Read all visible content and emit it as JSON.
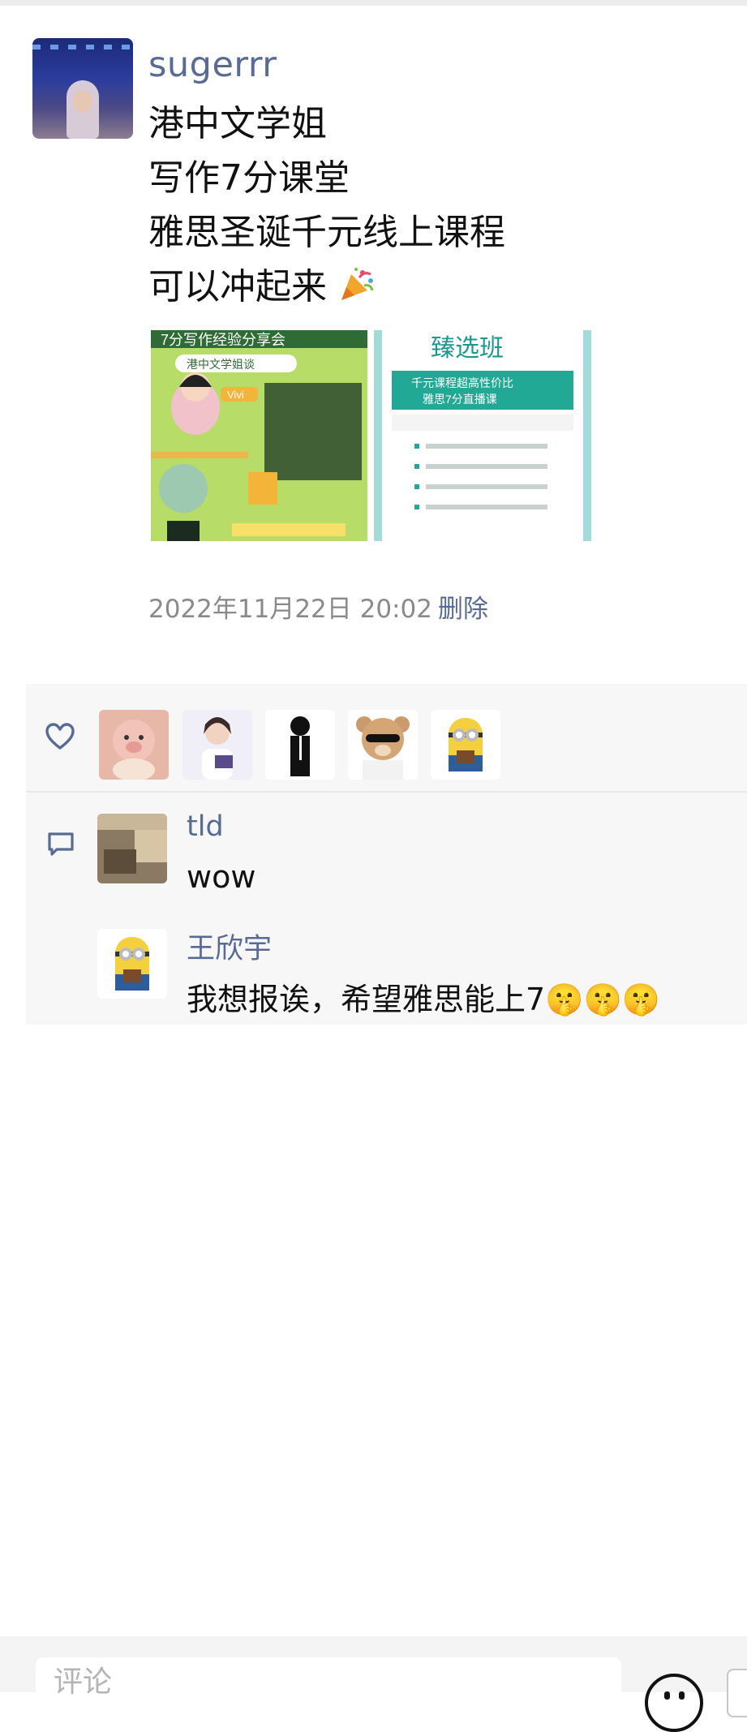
{
  "post": {
    "author": "sugerrr",
    "lines": [
      "港中文学姐",
      "写作7分课堂",
      "雅思圣诞千元线上课程",
      "可以冲起来"
    ],
    "timestamp": "2022年11月22日 20:02",
    "delete_label": "删除",
    "images": [
      {
        "name": "poster-writing-7",
        "header": "7分写作经验分享会",
        "subtitle": "港中文学姐谈",
        "tag": "Vivi"
      },
      {
        "name": "poster-select-class",
        "header": "臻选班",
        "subtitle": "千元课程超高性价比",
        "subtitle2": "雅思7分直播课"
      }
    ]
  },
  "likes": {
    "avatars": [
      "pig-teddy",
      "woman-portrait",
      "anime-black-figure",
      "bear-sunglasses",
      "minion"
    ]
  },
  "comments": [
    {
      "name": "tld",
      "text": "wow",
      "avatar": "room-photo"
    },
    {
      "name": "王欣宇",
      "text": "我想报诶，希望雅思能上7🤫🤫🤫",
      "avatar": "minion"
    }
  ],
  "composer": {
    "placeholder": "评论"
  },
  "colors": {
    "link": "#576b95",
    "meta": "#8a8a8a",
    "panel": "#f7f7f7"
  }
}
